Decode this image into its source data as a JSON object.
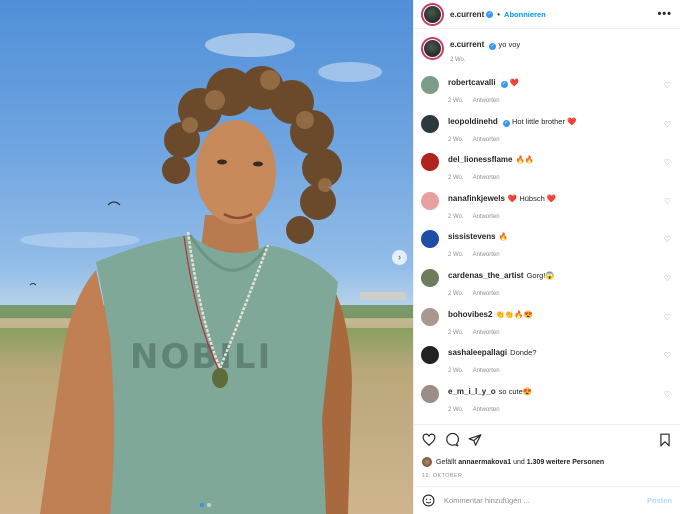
{
  "header": {
    "username": "e.current",
    "separator": "•",
    "follow_label": "Abonnieren",
    "more_icon": "more-horizontal-icon"
  },
  "caption": {
    "username": "e.current",
    "text": "yo voy",
    "time": "2 Wo."
  },
  "comments": [
    {
      "user": "robertcavalli",
      "verified": true,
      "text": "❤️",
      "time": "2 Wo.",
      "reply": "Antworten",
      "avatar_color": "#7c9c88"
    },
    {
      "user": "leopoldinehd",
      "verified": true,
      "text": "Hot little brother ❤️",
      "time": "2 Wo.",
      "reply": "Antworten",
      "avatar_color": "#2a3a3e"
    },
    {
      "user": "del_lionessflame",
      "verified": false,
      "text": "🔥🔥",
      "time": "2 Wo.",
      "reply": "Antworten",
      "avatar_color": "#b0241e"
    },
    {
      "user": "nanafinkjewels",
      "verified": false,
      "text": "❤️ Hübsch ❤️",
      "time": "2 Wo.",
      "reply": "Antworten",
      "avatar_color": "#e7a1a1"
    },
    {
      "user": "sissistevens",
      "verified": false,
      "text": "🔥",
      "time": "2 Wo.",
      "reply": "Antworten",
      "avatar_color": "#1f4ea8"
    },
    {
      "user": "cardenas_the_artist",
      "verified": false,
      "text": "Gorg!😱",
      "time": "2 Wo.",
      "reply": "Antworten",
      "avatar_color": "#6d7c5c"
    },
    {
      "user": "bohovibes2",
      "verified": false,
      "text": "👏👏🔥😍",
      "time": "2 Wo.",
      "reply": "Antworten",
      "avatar_color": "#a89890"
    },
    {
      "user": "sashaleepallagi",
      "verified": false,
      "text": "Donde?",
      "time": "2 Wo.",
      "reply": "Antworten",
      "avatar_color": "#222222"
    },
    {
      "user": "e_m_i_l_y_o",
      "verified": false,
      "text": "so cute😍",
      "time": "2 Wo.",
      "reply": "Antworten",
      "avatar_color": "#9c8e86"
    }
  ],
  "likes": {
    "prefix": "Gefällt",
    "user": "annaermakova1",
    "middle": "und",
    "count": "1.309 weitere Personen"
  },
  "date": "12. OKTOBER",
  "add_comment": {
    "placeholder": "Kommentar hinzufügen ...",
    "post_label": "Posten"
  },
  "carousel": {
    "slides": 2,
    "active_index": 0,
    "next_icon": "chevron-right-icon"
  },
  "photo": {
    "shirt_print": "NOBILI"
  }
}
